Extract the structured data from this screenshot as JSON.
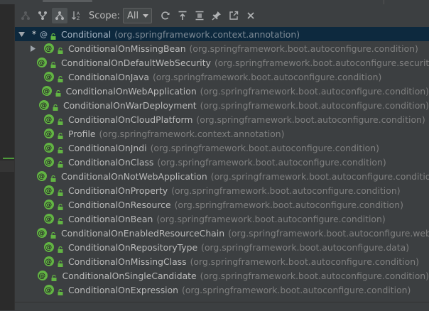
{
  "toolbar": {
    "scope_label": "Scope:",
    "scope_value": "All",
    "buttons": [
      {
        "icon": "subtypes-hierarchy-icon"
      },
      {
        "icon": "supertypes-hierarchy-icon"
      },
      {
        "icon": "class-hierarchy-icon"
      },
      {
        "icon": "sort-alphabetically-icon"
      }
    ],
    "actions": [
      {
        "icon": "refresh-icon"
      },
      {
        "icon": "export-icon"
      },
      {
        "icon": "expand-all-icon"
      },
      {
        "icon": "pin-icon"
      },
      {
        "icon": "open-in-window-icon"
      },
      {
        "icon": "close-icon"
      }
    ]
  },
  "tree": {
    "root": {
      "name": "Conditional",
      "pkg": "(org.springframework.context.annotation)"
    },
    "children": [
      {
        "name": "ConditionalOnMissingBean",
        "pkg": "(org.springframework.boot.autoconfigure.condition)",
        "expandable": true
      },
      {
        "name": "ConditionalOnDefaultWebSecurity",
        "pkg": "(org.springframework.boot.autoconfigure.security)",
        "expandable": false
      },
      {
        "name": "ConditionalOnJava",
        "pkg": "(org.springframework.boot.autoconfigure.condition)",
        "expandable": false
      },
      {
        "name": "ConditionalOnWebApplication",
        "pkg": "(org.springframework.boot.autoconfigure.condition)",
        "expandable": false
      },
      {
        "name": "ConditionalOnWarDeployment",
        "pkg": "(org.springframework.boot.autoconfigure.condition)",
        "expandable": false
      },
      {
        "name": "ConditionalOnCloudPlatform",
        "pkg": "(org.springframework.boot.autoconfigure.condition)",
        "expandable": false
      },
      {
        "name": "Profile",
        "pkg": "(org.springframework.context.annotation)",
        "expandable": false
      },
      {
        "name": "ConditionalOnJndi",
        "pkg": "(org.springframework.boot.autoconfigure.condition)",
        "expandable": false
      },
      {
        "name": "ConditionalOnClass",
        "pkg": "(org.springframework.boot.autoconfigure.condition)",
        "expandable": false
      },
      {
        "name": "ConditionalOnNotWebApplication",
        "pkg": "(org.springframework.boot.autoconfigure.condition)",
        "expandable": false
      },
      {
        "name": "ConditionalOnProperty",
        "pkg": "(org.springframework.boot.autoconfigure.condition)",
        "expandable": false
      },
      {
        "name": "ConditionalOnResource",
        "pkg": "(org.springframework.boot.autoconfigure.condition)",
        "expandable": false
      },
      {
        "name": "ConditionalOnBean",
        "pkg": "(org.springframework.boot.autoconfigure.condition)",
        "expandable": false
      },
      {
        "name": "ConditionalOnEnabledResourceChain",
        "pkg": "(org.springframework.boot.autoconfigure.web)",
        "expandable": false
      },
      {
        "name": "ConditionalOnRepositoryType",
        "pkg": "(org.springframework.boot.autoconfigure.data)",
        "expandable": false
      },
      {
        "name": "ConditionalOnMissingClass",
        "pkg": "(org.springframework.boot.autoconfigure.condition)",
        "expandable": false
      },
      {
        "name": "ConditionalOnSingleCandidate",
        "pkg": "(org.springframework.boot.autoconfigure.condition)",
        "expandable": false
      },
      {
        "name": "ConditionalOnExpression",
        "pkg": "(org.springframework.boot.autoconfigure.condition)",
        "expandable": false
      }
    ]
  },
  "colors": {
    "background": "#3c3f41",
    "selection": "#0d293e",
    "annotation_badge": "#62b543",
    "package_text": "#808080"
  }
}
